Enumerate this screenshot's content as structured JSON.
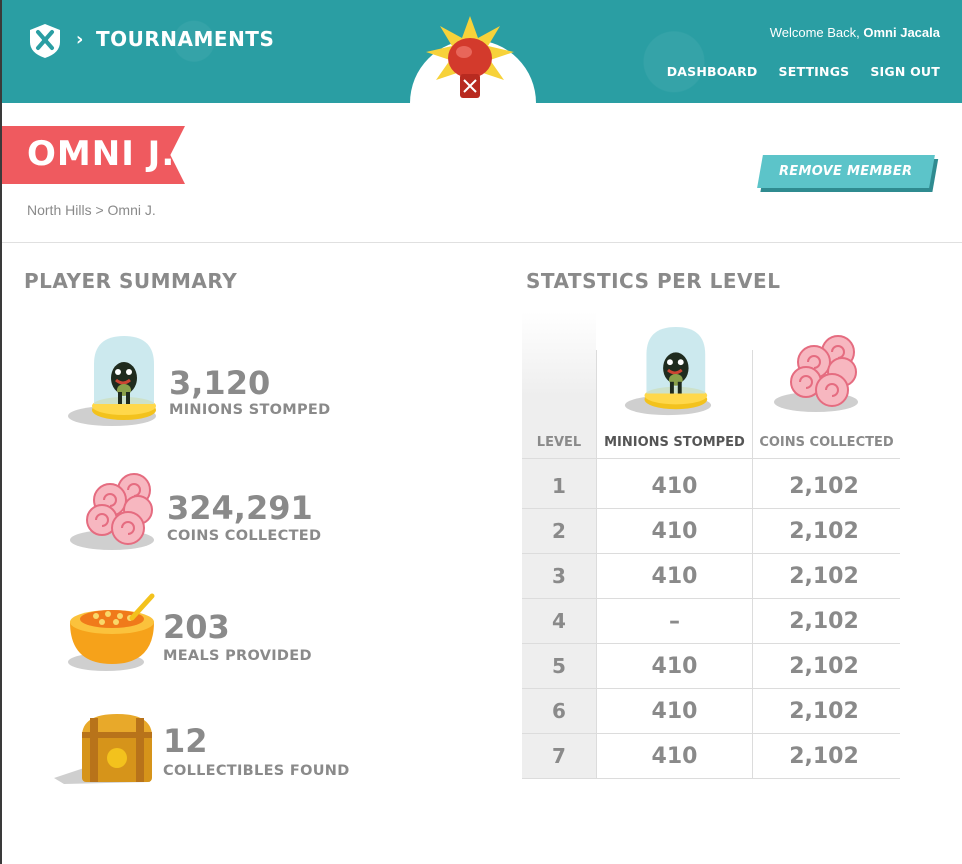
{
  "header": {
    "section_title": "TOURNAMENTS",
    "crumb_separator": "›",
    "welcome_prefix": "Welcome Back,",
    "user_name": "Omni Jacala",
    "nav": [
      "DASHBOARD",
      "SETTINGS",
      "SIGN OUT"
    ],
    "brand_color": "#2a9ea3"
  },
  "member": {
    "name": "OMNI J.",
    "breadcrumb": "North Hills > Omni J.",
    "remove_label": "REMOVE MEMBER",
    "ribbon_color": "#ef5a5f",
    "button_color": "#5cc4c9"
  },
  "summary": {
    "title": "PLAYER SUMMARY",
    "stats": [
      {
        "value": "3,120",
        "label": "MINIONS STOMPED",
        "icon": "minion-trophy-icon"
      },
      {
        "value": "324,291",
        "label": "COINS COLLECTED",
        "icon": "coins-icon"
      },
      {
        "value": "203",
        "label": "MEALS PROVIDED",
        "icon": "meal-bowl-icon"
      },
      {
        "value": "12",
        "label": "COLLECTIBLES FOUND",
        "icon": "treasure-chest-icon"
      }
    ]
  },
  "level_stats": {
    "title": "STATSTICS PER LEVEL",
    "headers": [
      "LEVEL",
      "MINIONS STOMPED",
      "COINS COLLECTED"
    ],
    "rows": [
      [
        "1",
        "410",
        "2,102"
      ],
      [
        "2",
        "410",
        "2,102"
      ],
      [
        "3",
        "410",
        "2,102"
      ],
      [
        "4",
        "–",
        "2,102"
      ],
      [
        "5",
        "410",
        "2,102"
      ],
      [
        "6",
        "410",
        "2,102"
      ],
      [
        "7",
        "410",
        "2,102"
      ]
    ]
  }
}
